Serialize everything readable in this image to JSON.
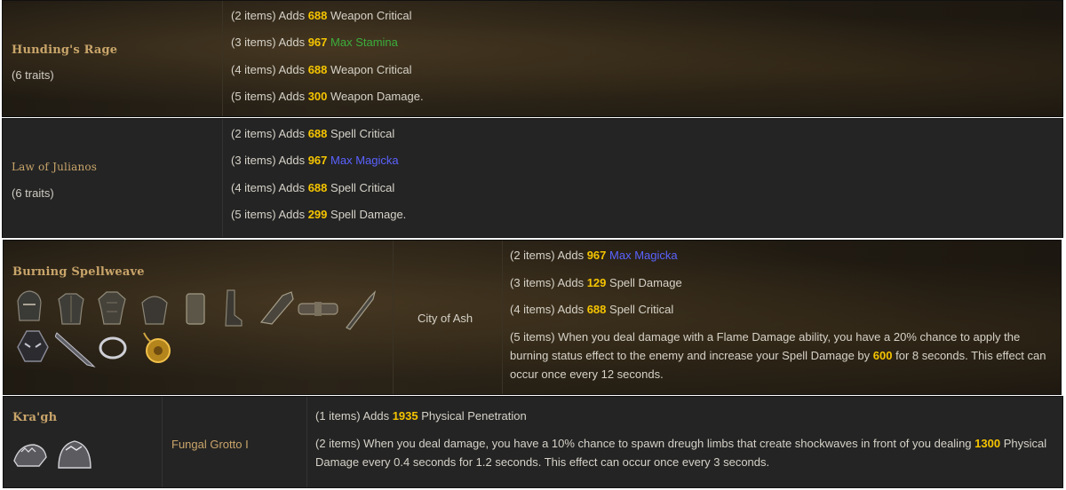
{
  "sets": [
    {
      "name": "Hunding's Rage",
      "traits": "(6 traits)",
      "bonuses": [
        {
          "pre": "(2 items) Adds ",
          "num": "688",
          "post": " Weapon Critical"
        },
        {
          "pre": "(3 items) Adds ",
          "num": "967",
          "post": " Max Stamina"
        },
        {
          "pre": "(4 items) Adds ",
          "num": "688",
          "post": " Weapon Critical"
        },
        {
          "pre": "(5 items) Adds ",
          "num": "300",
          "post": " Weapon Damage."
        }
      ]
    },
    {
      "name": "Law of Julianos",
      "traits": "(6 traits)",
      "bonuses": [
        {
          "pre": "(2 items) Adds ",
          "num": "688",
          "post": " Spell Critical"
        },
        {
          "pre": "(3 items) Adds ",
          "num": "967",
          "post": " Max Magicka"
        },
        {
          "pre": "(4 items) Adds ",
          "num": "688",
          "post": " Spell Critical"
        },
        {
          "pre": "(5 items) Adds ",
          "num": "299",
          "post": " Spell Damage."
        }
      ]
    },
    {
      "name": "Burning Spellweave",
      "location": "City of Ash",
      "bonuses": [
        {
          "pre": "(2 items) Adds ",
          "num": "967",
          "post": " Max Magicka"
        },
        {
          "pre": "(3 items) Adds ",
          "num": "129",
          "post": " Spell Damage"
        },
        {
          "pre": "(4 items) Adds ",
          "num": "688",
          "post": " Spell Critical"
        },
        {
          "pre": "(5 items) When you deal damage with a Flame Damage ability, you have a 20% chance to apply the burning status effect to the enemy and increase your Spell Damage by ",
          "num": "600",
          "post": " for 8 seconds. This effect can occur once every 12 seconds."
        }
      ],
      "item_icons": [
        "helmet-icon",
        "chest-armor-icon",
        "jerkin-icon",
        "robe-icon",
        "shoulder-icon",
        "skirt-icon",
        "boots-icon",
        "gauntlet-icon",
        "belt-icon",
        "sword-icon",
        "mask-icon",
        "dagger-icon",
        "ring-icon",
        "amulet-icon"
      ]
    },
    {
      "name": "Kra'gh",
      "location": "Fungal Grotto I",
      "bonuses": [
        {
          "pre": "(1 items) Adds ",
          "num": "1935",
          "post": " Physical Penetration"
        },
        {
          "pre": "(2 items) When you deal damage, you have a 10% chance to spawn dreugh limbs that create shockwaves in front of you dealing ",
          "num": "1300",
          "post": " Physical Damage every 0.4 seconds for 1.2 seconds. This effect can occur once every 3 seconds."
        }
      ],
      "item_icons": [
        "dreugh-helmet-icon",
        "dreugh-shoulder-icon"
      ]
    }
  ],
  "colors": {
    "accent_number": "#f5c400",
    "stamina": "#3cae3c",
    "magicka": "#5a62ff",
    "set_name": "#c9a56a"
  }
}
